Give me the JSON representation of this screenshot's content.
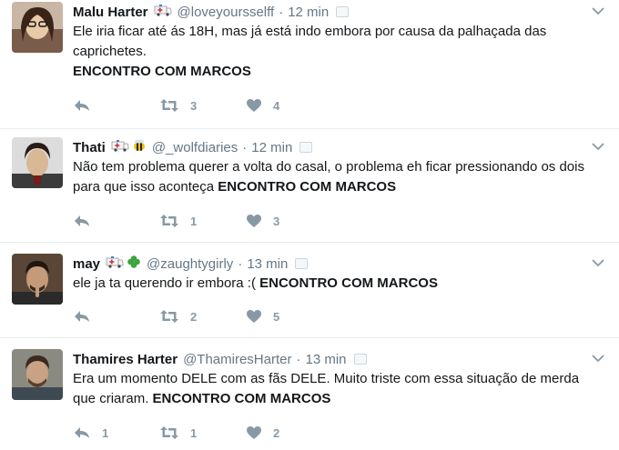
{
  "tweets": [
    {
      "name": "Malu Harter",
      "handle": "@loveyoursselff",
      "time": "12 min",
      "emojis": [
        "ambulance-icon"
      ],
      "text": "Ele iria ficar até ás 18H, mas já está indo embora por causa da palhaçada das caprichetes.",
      "bold": "ENCONTRO COM MARCOS",
      "replies": "",
      "retweets": "3",
      "likes": "4"
    },
    {
      "name": "Thati",
      "handle": "@_wolfdiaries",
      "time": "12 min",
      "emojis": [
        "ambulance-icon",
        "bee-icon"
      ],
      "text": "Não tem problema querer a volta do casal, o problema eh ficar pressionando os dois para que isso aconteça",
      "bold": "ENCONTRO COM MARCOS",
      "replies": "",
      "retweets": "1",
      "likes": "3"
    },
    {
      "name": "may",
      "handle": "@zaughtygirly",
      "time": "13 min",
      "emojis": [
        "ambulance-icon",
        "clover-icon"
      ],
      "text": "ele ja ta querendo ir embora :(",
      "bold": "ENCONTRO COM MARCOS",
      "replies": "",
      "retweets": "2",
      "likes": "5"
    },
    {
      "name": "Thamires Harter",
      "handle": "@ThamiresHarter",
      "time": "13 min",
      "emojis": [],
      "text": "Era um momento DELE com as fãs DELE. Muito triste com essa situação de merda que criaram.",
      "bold": "ENCONTRO COM MARCOS",
      "replies": "1",
      "retweets": "1",
      "likes": "2"
    }
  ],
  "dot": "·",
  "colors": {
    "icon": "#8899a6",
    "muted": "#657786",
    "text": "#14171a",
    "border": "#e6ecf0"
  }
}
